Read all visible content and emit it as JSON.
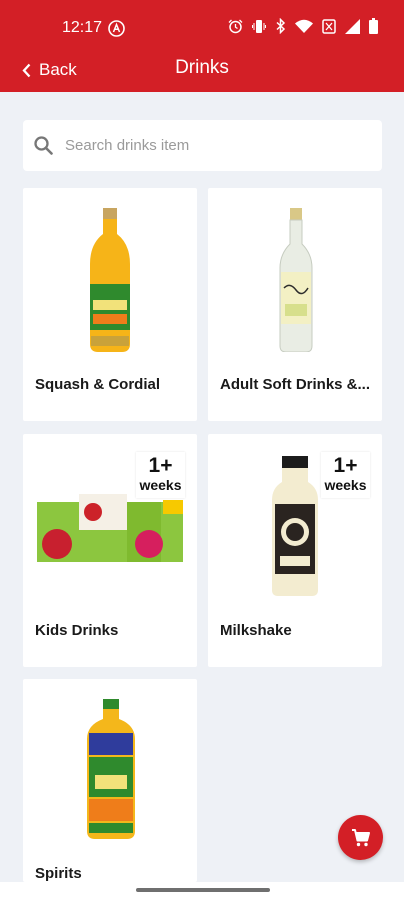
{
  "status_bar": {
    "time": "12:17",
    "icons": [
      "app-notification-icon",
      "alarm-icon",
      "vibrate-icon",
      "bluetooth-icon",
      "wifi-icon",
      "data-saver-icon",
      "signal-icon",
      "battery-icon"
    ]
  },
  "header": {
    "back_label": "Back",
    "title": "Drinks"
  },
  "search": {
    "placeholder": "Search drinks item"
  },
  "categories": [
    {
      "label": "Squash & Cordial"
    },
    {
      "label": "Adult Soft Drinks &..."
    },
    {
      "label": "Kids Drinks",
      "badge_number": "1+",
      "badge_unit": "weeks"
    },
    {
      "label": "Milkshake",
      "badge_number": "1+",
      "badge_unit": "weeks"
    },
    {
      "label": "Spirits"
    }
  ],
  "colors": {
    "brand_red": "#d31f26",
    "background": "#eef1f6",
    "card": "#ffffff",
    "placeholder_text": "#9a9a9a"
  },
  "fab": {
    "icon": "shopping-cart-icon"
  }
}
